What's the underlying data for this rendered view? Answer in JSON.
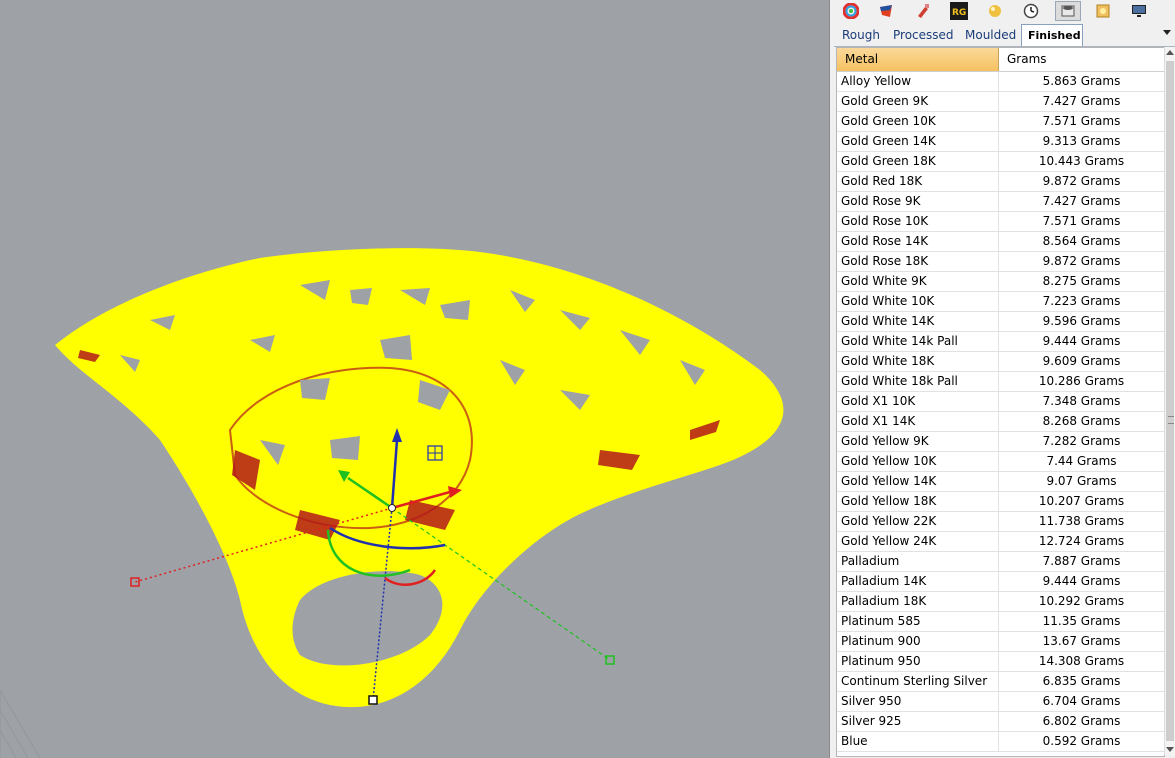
{
  "toolbar": {
    "icons": [
      "color-wheel-icon",
      "material-icon",
      "paint-icon",
      "rg-icon",
      "sphere-icon",
      "clock-icon",
      "ring-icon",
      "gem-icon",
      "display-icon"
    ],
    "rg_label": "RG",
    "active_index": 6
  },
  "tabs": [
    {
      "label": "Rough",
      "active": false
    },
    {
      "label": "Processed",
      "active": false
    },
    {
      "label": "Moulded",
      "active": false
    },
    {
      "label": "Finished",
      "active": true
    }
  ],
  "grid": {
    "columns": {
      "metal": "Metal",
      "grams": "Grams"
    },
    "rows": [
      {
        "metal": "Alloy Yellow",
        "grams": "5.863 Grams"
      },
      {
        "metal": "Gold Green 9K",
        "grams": "7.427 Grams"
      },
      {
        "metal": "Gold Green 10K",
        "grams": "7.571 Grams"
      },
      {
        "metal": "Gold Green 14K",
        "grams": "9.313 Grams"
      },
      {
        "metal": "Gold Green 18K",
        "grams": "10.443 Grams"
      },
      {
        "metal": "Gold Red 18K",
        "grams": "9.872 Grams"
      },
      {
        "metal": "Gold Rose 9K",
        "grams": "7.427 Grams"
      },
      {
        "metal": "Gold Rose 10K",
        "grams": "7.571 Grams"
      },
      {
        "metal": "Gold Rose 14K",
        "grams": "8.564 Grams"
      },
      {
        "metal": "Gold Rose 18K",
        "grams": "9.872 Grams"
      },
      {
        "metal": "Gold White 9K",
        "grams": "8.275 Grams"
      },
      {
        "metal": "Gold White 10K",
        "grams": "7.223 Grams"
      },
      {
        "metal": "Gold White 14K",
        "grams": "9.596 Grams"
      },
      {
        "metal": "Gold White 14k Pall",
        "grams": "9.444 Grams"
      },
      {
        "metal": "Gold White 18K",
        "grams": "9.609 Grams"
      },
      {
        "metal": "Gold White 18k Pall",
        "grams": "10.286 Grams"
      },
      {
        "metal": "Gold X1 10K",
        "grams": "7.348 Grams"
      },
      {
        "metal": "Gold X1 14K",
        "grams": "8.268 Grams"
      },
      {
        "metal": "Gold Yellow 9K",
        "grams": "7.282 Grams"
      },
      {
        "metal": "Gold Yellow 10K",
        "grams": "7.44 Grams"
      },
      {
        "metal": "Gold Yellow 14K",
        "grams": "9.07 Grams"
      },
      {
        "metal": "Gold Yellow 18K",
        "grams": "10.207 Grams"
      },
      {
        "metal": "Gold Yellow 22K",
        "grams": "11.738 Grams"
      },
      {
        "metal": "Gold Yellow 24K",
        "grams": "12.724 Grams"
      },
      {
        "metal": "Palladium",
        "grams": "7.887 Grams"
      },
      {
        "metal": "Palladium 14K",
        "grams": "9.444 Grams"
      },
      {
        "metal": "Palladium 18K",
        "grams": "10.292 Grams"
      },
      {
        "metal": "Platinum 585",
        "grams": "11.35 Grams"
      },
      {
        "metal": "Platinum 900",
        "grams": "13.67 Grams"
      },
      {
        "metal": "Platinum 950",
        "grams": "14.308 Grams"
      },
      {
        "metal": "Continum Sterling Silver",
        "grams": "6.835 Grams"
      },
      {
        "metal": "Silver 950",
        "grams": "6.704 Grams"
      },
      {
        "metal": "Silver 925",
        "grams": "6.802 Grams"
      },
      {
        "metal": "Blue",
        "grams": "0.592 Grams"
      }
    ]
  },
  "viewport": {
    "background": "#9ea2a7",
    "model_color": "#ffff00",
    "inner_color": "#b31a1a",
    "gumball": {
      "x_color": "#e02020",
      "y_color": "#20c020",
      "z_color": "#2030b0"
    }
  }
}
